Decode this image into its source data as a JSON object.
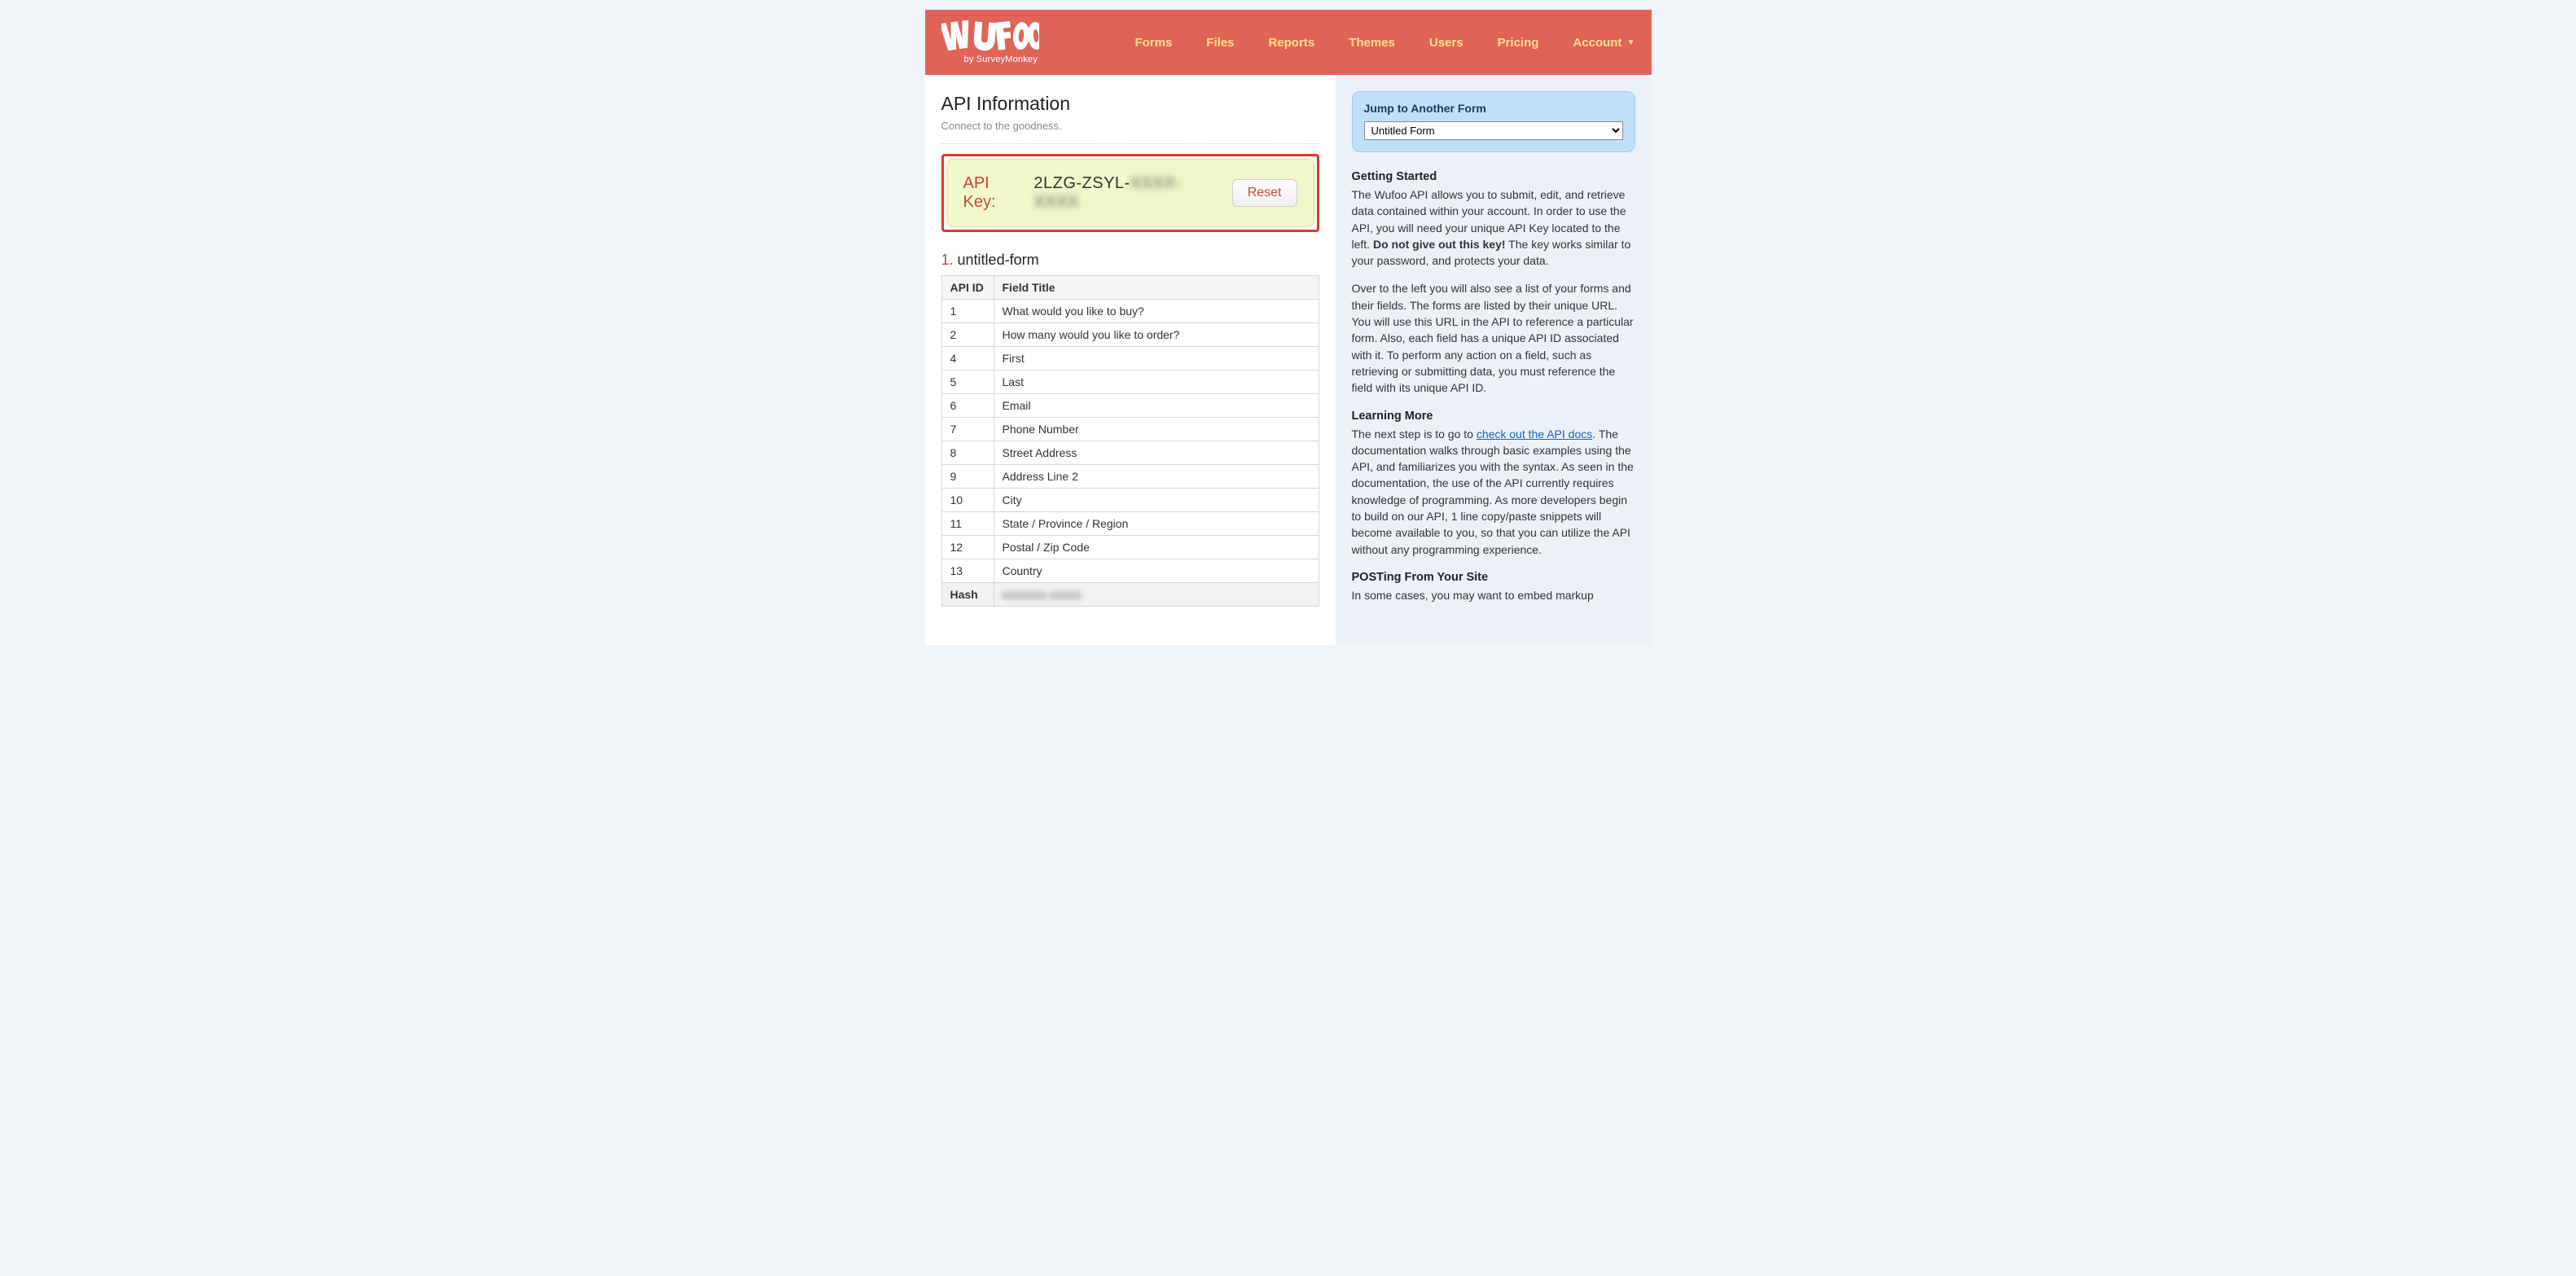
{
  "brand": {
    "name": "WUFOO",
    "byline": "by SurveyMonkey"
  },
  "nav": {
    "forms": "Forms",
    "files": "Files",
    "reports": "Reports",
    "themes": "Themes",
    "users": "Users",
    "pricing": "Pricing",
    "account": "Account"
  },
  "page": {
    "title": "API Information",
    "subtitle": "Connect to the goodness."
  },
  "apiKey": {
    "label": "API Key:",
    "visible": "2LZG-ZSYL-",
    "hidden": "XXXX-XXXX",
    "reset": "Reset"
  },
  "form": {
    "number": "1.",
    "name": "untitled-form",
    "headers": {
      "id": "API ID",
      "title": "Field Title"
    },
    "rows": [
      {
        "id": "1",
        "title": "What would you like to buy?"
      },
      {
        "id": "2",
        "title": "How many would you like to order?"
      },
      {
        "id": "4",
        "title": "First"
      },
      {
        "id": "5",
        "title": "Last"
      },
      {
        "id": "6",
        "title": "Email"
      },
      {
        "id": "7",
        "title": "Phone Number"
      },
      {
        "id": "8",
        "title": "Street Address"
      },
      {
        "id": "9",
        "title": "Address Line 2"
      },
      {
        "id": "10",
        "title": "City"
      },
      {
        "id": "11",
        "title": "State / Province / Region"
      },
      {
        "id": "12",
        "title": "Postal / Zip Code"
      },
      {
        "id": "13",
        "title": "Country"
      }
    ],
    "hashLabel": "Hash",
    "hashValue": "xxxxxxx xxxxx"
  },
  "sidebar": {
    "jump": {
      "heading": "Jump to Another Form",
      "selected": "Untitled Form"
    },
    "gettingStarted": {
      "heading": "Getting Started",
      "p1a": "The Wufoo API allows you to submit, edit, and retrieve data contained within your account. In order to use the API, you will need your unique API Key located to the left. ",
      "p1b": "Do not give out this key!",
      "p1c": " The key works similar to your password, and protects your data.",
      "p2": "Over to the left you will also see a list of your forms and their fields. The forms are listed by their unique URL. You will use this URL in the API to reference a particular form. Also, each field has a unique API ID associated with it. To perform any action on a field, such as retrieving or submitting data, you must reference the field with its unique API ID."
    },
    "learningMore": {
      "heading": "Learning More",
      "p1a": "The next step is to go to ",
      "link": "check out the API docs",
      "p1b": ". The documentation walks through basic examples using the API, and familiarizes you with the syntax. As seen in the documentation, the use of the API currently requires knowledge of programming. As more developers begin to build on our API, 1 line copy/paste snippets will become available to you, so that you can utilize the API without any programming experience."
    },
    "posting": {
      "heading": "POSTing From Your Site",
      "p1": "In some cases, you may want to embed markup"
    }
  }
}
